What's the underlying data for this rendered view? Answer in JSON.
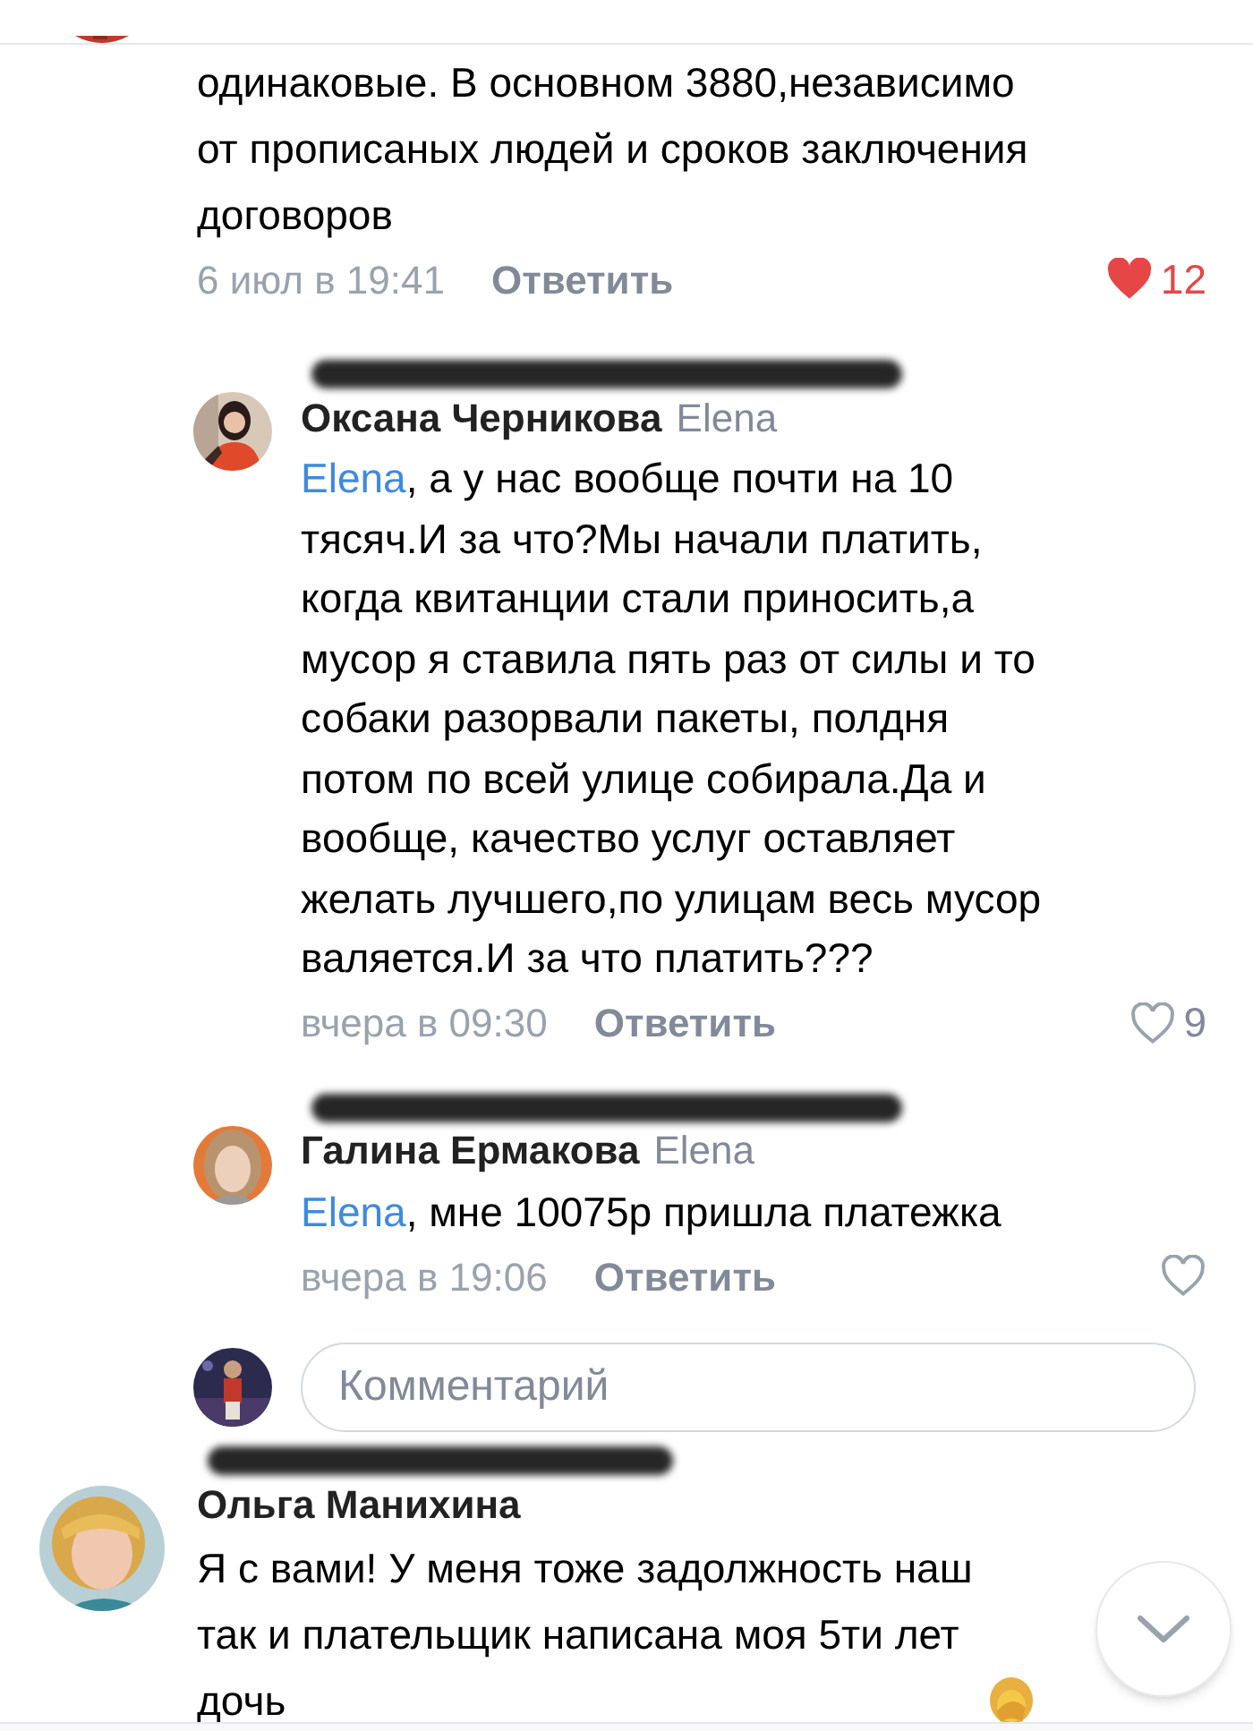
{
  "top_comment": {
    "text": "одинаковые. В основном 3880,независимо\nот прописаных людей и сроков заключения\nдоговоров",
    "time": "6 июл в 19:41",
    "reply_label": "Ответить",
    "liked": true,
    "likes": "12"
  },
  "replies": [
    {
      "author": "Оксана Черникова",
      "addressee": "Elena",
      "mention": "Elena",
      "text": ", а у нас вообще почти на 10\nтясяч.И за что?Мы начали платить,\nкогда квитанции стали приносить,а\nмусор я ставила пять раз от силы и то\nсобаки разорвали пакеты, полдня\nпотом по всей улице собирала.Да и\nвообще, качество услуг оставляет\nжелать лучшего,по улицам весь мусор\nваляется.И за что платить???",
      "time": "вчера в 09:30",
      "reply_label": "Ответить",
      "liked": false,
      "likes": "9"
    },
    {
      "author": "Галина Ермакова",
      "addressee": "Elena",
      "mention": "Elena",
      "text": ", мне 10075р пришла платежка",
      "time": "вчера в 19:06",
      "reply_label": "Ответить",
      "liked": false
    }
  ],
  "comment_field": {
    "placeholder": "Комментарий"
  },
  "last_comment": {
    "author": "Ольга Манихина",
    "text": "Я с вами! У меня тоже задолжность наш\nтак и плательщик написана моя 5ти лет\nдочь"
  }
}
